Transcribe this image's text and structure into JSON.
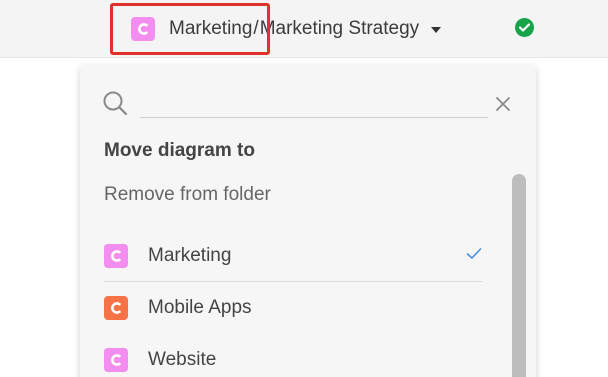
{
  "header": {
    "folder_name": "Marketing",
    "separator": "/",
    "diagram_name": "Marketing Strategy",
    "folder_icon": "folder-c-icon",
    "dropdown_icon": "caret-down-icon",
    "status_icon": "check-circle-icon",
    "status_color": "#16a34a",
    "highlight_color": "#e0312b"
  },
  "dropdown": {
    "search": {
      "value": "",
      "placeholder": ""
    },
    "clear_icon": "close-icon",
    "title": "Move diagram to",
    "remove_label": "Remove from folder",
    "folders": [
      {
        "label": "Marketing",
        "icon": "folder-c-icon",
        "color": "#f38ef0",
        "selected": true
      },
      {
        "label": "Mobile Apps",
        "icon": "folder-c-icon",
        "color": "#f57347",
        "selected": false
      },
      {
        "label": "Website",
        "icon": "folder-c-icon",
        "color": "#f38ef0",
        "selected": false
      }
    ],
    "selected_check_color": "#4a90e2"
  }
}
